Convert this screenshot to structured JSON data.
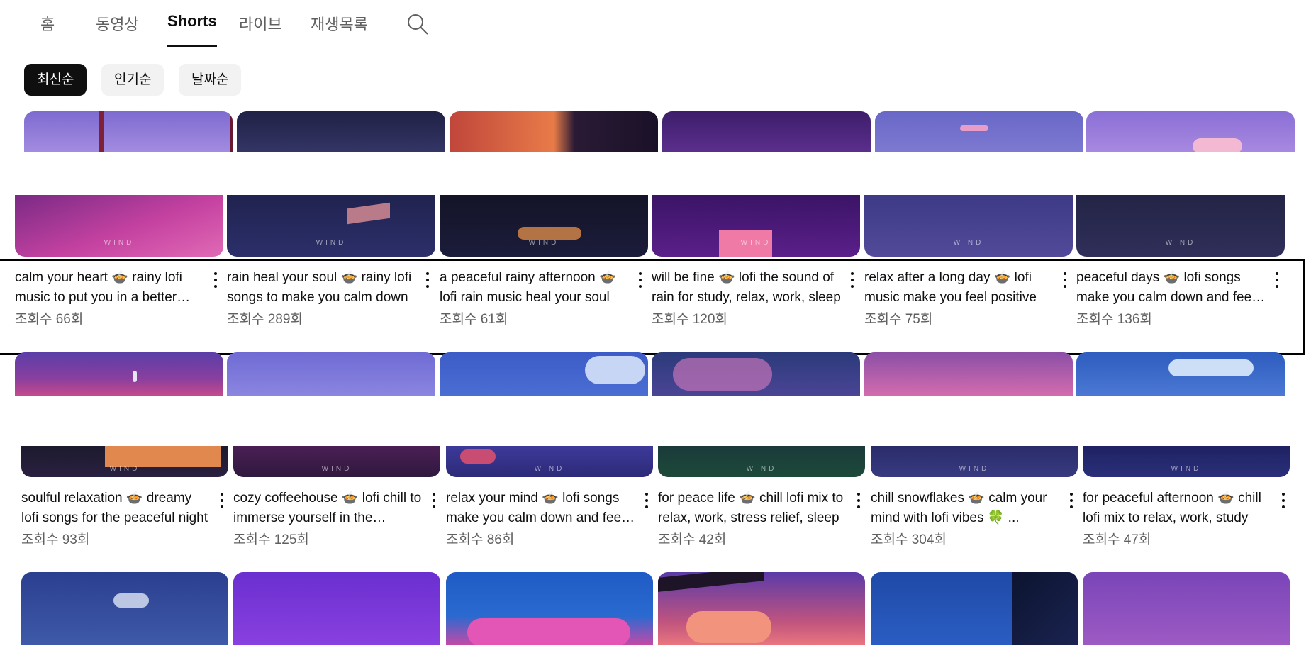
{
  "tabs": [
    {
      "label": "홈",
      "active": false
    },
    {
      "label": "동영상",
      "active": false
    },
    {
      "label": "Shorts",
      "active": true
    },
    {
      "label": "라이브",
      "active": false
    },
    {
      "label": "재생목록",
      "active": false
    }
  ],
  "search_icon": "search-icon",
  "chips": [
    {
      "label": "최신순",
      "active": true
    },
    {
      "label": "인기순",
      "active": false
    },
    {
      "label": "날짜순",
      "active": false
    }
  ],
  "watermark": "WIND",
  "rows": [
    {
      "videos": [
        {
          "title": "calm your heart 🍲 rainy lofi music to put you in a better mood",
          "views": "조회수 66회"
        },
        {
          "title": "rain heal your soul 🍲 rainy lofi songs to make you calm down",
          "views": "조회수 289회"
        },
        {
          "title": "a peaceful rainy afternoon 🍲 lofi rain music heal your soul",
          "views": "조회수 61회"
        },
        {
          "title": "will be fine 🍲 lofi the sound of rain for study, relax, work, sleep",
          "views": "조회수 120회"
        },
        {
          "title": "relax after a long day 🍲 lofi music make you feel positive",
          "views": "조회수 75회"
        },
        {
          "title": "peaceful days 🍲 lofi songs make you calm down and feel peaceful",
          "views": "조회수 136회"
        }
      ]
    },
    {
      "videos": [
        {
          "title": "soulful relaxation 🍲 dreamy lofi songs for the peaceful night",
          "views": "조회수 93회"
        },
        {
          "title": "cozy coffeehouse 🍲 lofi chill to immerse yourself in the moment",
          "views": "조회수 125회"
        },
        {
          "title": "relax your mind 🍲 lofi songs make you calm down and feel better",
          "views": "조회수 86회"
        },
        {
          "title": "for peace life 🍲 chill lofi mix to relax, work, stress relief, sleep",
          "views": "조회수 42회"
        },
        {
          "title": "chill snowflakes 🍲 calm your mind with lofi vibes 🍀 ...",
          "views": "조회수 304회"
        },
        {
          "title": "for peaceful afternoon 🍲 chill lofi mix to relax, work, study",
          "views": "조회수 47회"
        }
      ]
    }
  ],
  "colors": {
    "accent": "#0f0f0f",
    "secondary_text": "#606060",
    "chip_bg": "#f2f2f2"
  }
}
